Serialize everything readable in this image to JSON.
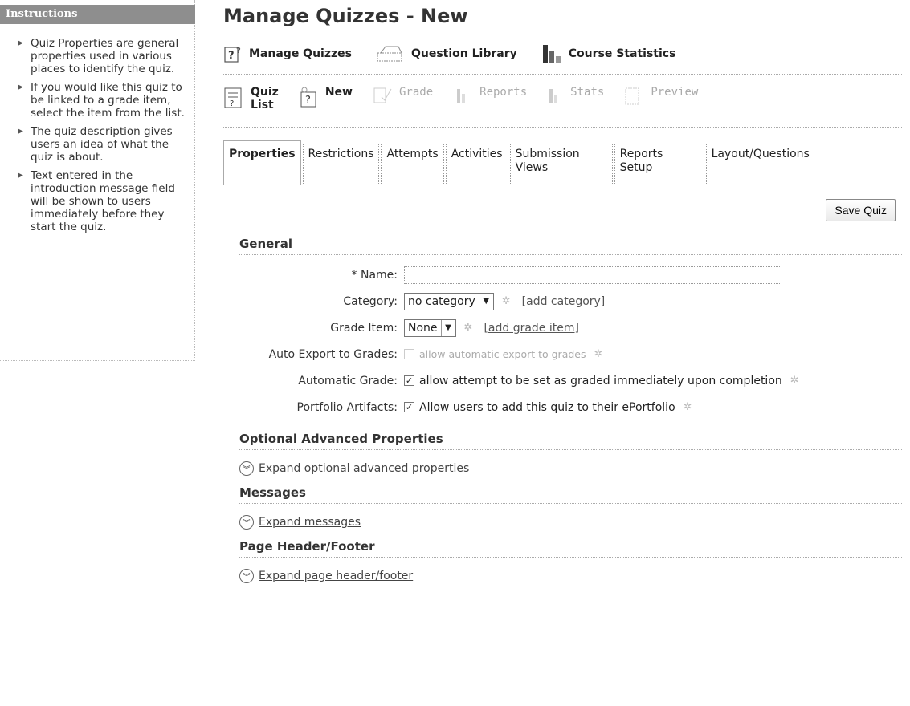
{
  "sidebar": {
    "title": "Instructions",
    "items": [
      "Quiz Properties are general properties used in various places to identify the quiz.",
      "If you would like this quiz to be linked to a grade item, select the item from the list.",
      "The quiz description gives users an idea of what the quiz is about.",
      "Text entered in the introduction message field will be shown to users immediately before they start the quiz."
    ]
  },
  "page": {
    "title": "Manage Quizzes - New"
  },
  "nav": {
    "manage_quizzes": "Manage Quizzes",
    "question_library": "Question Library",
    "course_statistics": "Course Statistics"
  },
  "subnav": {
    "quiz_list_1": "Quiz",
    "quiz_list_2": "List",
    "new": "New",
    "grade": "Grade",
    "reports": "Reports",
    "stats": "Stats",
    "preview": "Preview"
  },
  "tabs": {
    "properties": "Properties",
    "restrictions": "Restrictions",
    "attempts": "Attempts",
    "activities": "Activities",
    "submission_views_1": "Submission",
    "submission_views_2": "Views",
    "reports_setup_1": "Reports",
    "reports_setup_2": "Setup",
    "layout_questions": "Layout/Questions"
  },
  "toolbar": {
    "save_label": "Save Quiz"
  },
  "general": {
    "heading": "General",
    "name_required": "*",
    "name_label": "Name:",
    "name_value": "",
    "category_label": "Category:",
    "category_value": "no category",
    "add_category": "[add category]",
    "grade_item_label": "Grade Item:",
    "grade_item_value": "None",
    "add_grade_item": "[add grade item]",
    "auto_export_label": "Auto Export to Grades:",
    "auto_export_text": "allow automatic export to grades",
    "auto_export_checked": false,
    "auto_grade_label": "Automatic Grade:",
    "auto_grade_text": "allow attempt to be set as graded immediately upon completion",
    "auto_grade_checked": true,
    "portfolio_label": "Portfolio Artifacts:",
    "portfolio_text": "Allow users to add this quiz to their ePortfolio",
    "portfolio_checked": true
  },
  "advanced": {
    "heading": "Optional Advanced Properties",
    "expand": "Expand optional advanced properties"
  },
  "messages": {
    "heading": "Messages",
    "expand": "Expand messages"
  },
  "header_footer": {
    "heading": "Page Header/Footer",
    "expand": "Expand page header/footer"
  }
}
